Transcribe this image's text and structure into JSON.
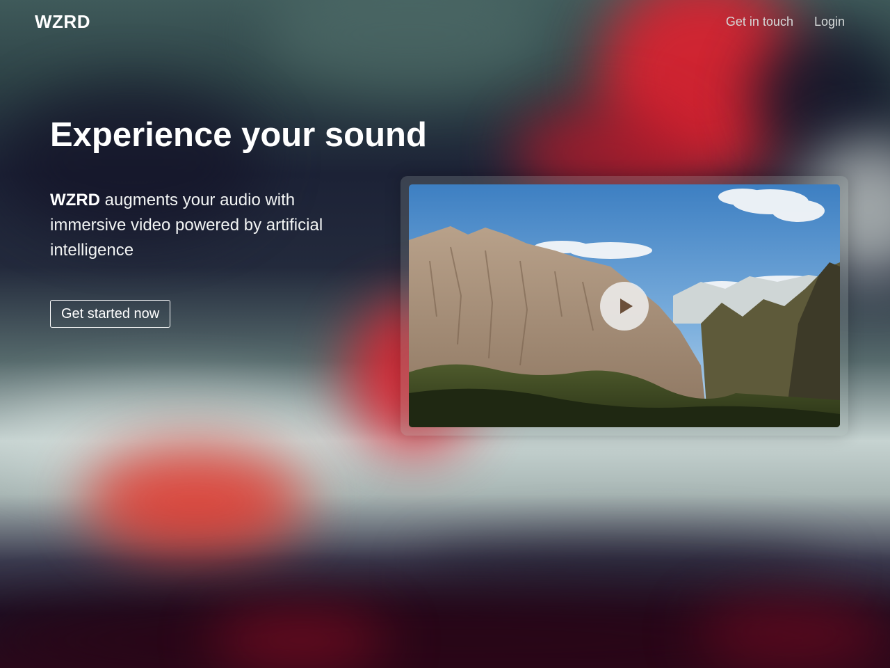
{
  "header": {
    "logo": "WZRD",
    "nav": [
      {
        "label": "Get in touch"
      },
      {
        "label": "Login"
      }
    ]
  },
  "hero": {
    "title": "Experience your sound",
    "description_brand": "WZRD",
    "description_rest": " augments your audio with immersive video powered by artificial intelligence",
    "cta_label": "Get started now"
  },
  "video": {
    "thumbnail": "mountain-landscape",
    "play_icon": "play-icon"
  },
  "colors": {
    "text": "#ffffff",
    "nav_text": "#d6dada",
    "accent_red": "#e0212f"
  }
}
